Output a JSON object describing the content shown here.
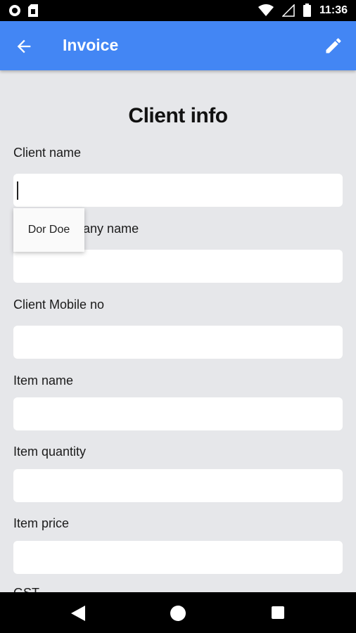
{
  "status_bar": {
    "time": "11:36",
    "icons": [
      "record-icon",
      "sim-card-icon",
      "wifi-icon",
      "no-signal-icon",
      "battery-icon"
    ]
  },
  "app_bar": {
    "title": "Invoice",
    "back_icon": "arrow-back-icon",
    "edit_icon": "pencil-edit-icon",
    "color": "#4386f4"
  },
  "form": {
    "section_title": "Client info",
    "fields": [
      {
        "label": "Client name",
        "value": ""
      },
      {
        "label": "Client Company name",
        "value": ""
      },
      {
        "label": "Client Mobile no",
        "value": ""
      },
      {
        "label": "Item name",
        "value": ""
      },
      {
        "label": "Item quantity",
        "value": ""
      },
      {
        "label": "Item price",
        "value": ""
      },
      {
        "label": "GST",
        "value": ""
      }
    ],
    "autocomplete_suggestion": "Dor Doe"
  },
  "nav_bar": {
    "icons": [
      "nav-back-icon",
      "nav-home-icon",
      "nav-recent-apps-icon"
    ]
  }
}
